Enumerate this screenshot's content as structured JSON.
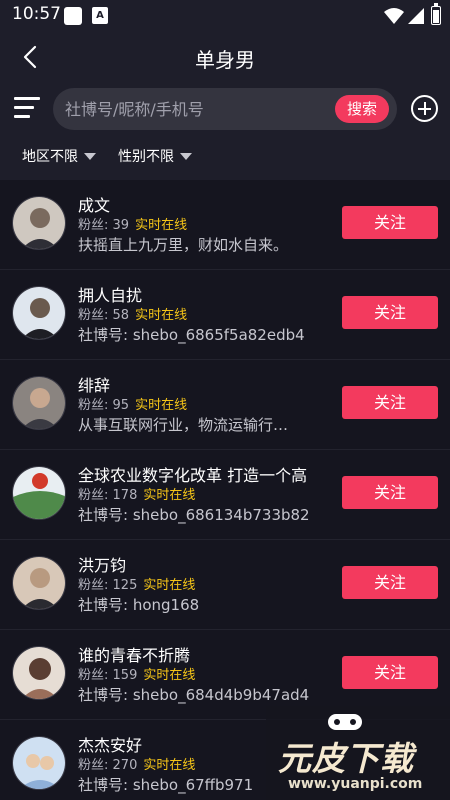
{
  "status_bar": {
    "time": "10:57",
    "notification_icon": "A"
  },
  "header": {
    "title": "单身男",
    "search_placeholder": "社博号/昵称/手机号",
    "search_button": "搜索",
    "filters": {
      "region": "地区不限",
      "gender": "性别不限"
    }
  },
  "labels": {
    "fans_prefix": "粉丝:",
    "follow": "关注"
  },
  "users": [
    {
      "name": "成文",
      "fans": "39",
      "online": "实时在线",
      "desc": "扶摇直上九万里，财如水自来。",
      "avatar_color": "#7a6a5e",
      "has_follow": true
    },
    {
      "name": "拥人自扰",
      "fans": "58",
      "online": "实时在线",
      "desc": "社博号: shebo_6865f5a82edb4",
      "avatar_color": "#6a7a88",
      "has_follow": true
    },
    {
      "name": "绯辞",
      "fans": "95",
      "online": "实时在线",
      "desc": "从事互联网行业，物流运输行…",
      "avatar_color": "#8a8480",
      "has_follow": true
    },
    {
      "name": "全球农业数字化改革 打造一个高",
      "fans": "178",
      "online": "实时在线",
      "desc": "社博号: shebo_686134b733b82",
      "avatar_color": "#4f8a4a",
      "has_follow": true
    },
    {
      "name": "洪万钧",
      "fans": "125",
      "online": "实时在线",
      "desc": "社博号: hong168",
      "avatar_color": "#b89a80",
      "has_follow": true
    },
    {
      "name": "谁的青春不折腾",
      "fans": "159",
      "online": "实时在线",
      "desc": "社博号: shebo_684d4b9b47ad4",
      "avatar_color": "#9a6e5a",
      "has_follow": true
    },
    {
      "name": "杰杰安好",
      "fans": "270",
      "online": "实时在线",
      "desc": "社博号: shebo_67ffb971",
      "avatar_color": "#8fb0d8",
      "has_follow": false
    }
  ],
  "watermark": {
    "text": "元皮下载",
    "url": "www.yuanpi.com"
  }
}
